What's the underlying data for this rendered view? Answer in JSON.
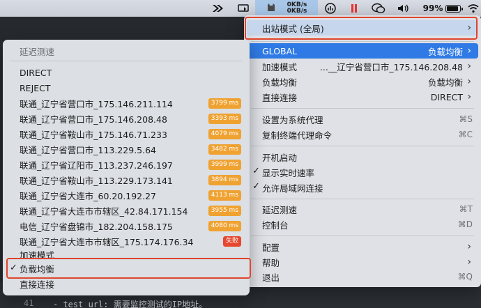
{
  "menubar": {
    "speed_up": "0KB/s",
    "speed_down": "0KB/s",
    "battery_percent": "99%"
  },
  "editor": {
    "line_number": "41",
    "code": "- test_url: 需要监控测试的IP地址。"
  },
  "main_menu": {
    "outbound_mode": "出站模式 (全局)",
    "global_label": "GLOBAL",
    "global_value": "负载均衡",
    "accel_label": "加速模式",
    "accel_value": "...__辽宁省营口市_175.146.208.48",
    "lb_label": "负载均衡",
    "lb_value": "负载均衡",
    "direct_label": "直接连接",
    "direct_value": "DIRECT",
    "set_proxy": "设置为系统代理",
    "set_proxy_sc": "⌘S",
    "copy_cmd": "复制终端代理命令",
    "copy_cmd_sc": "⌘C",
    "autostart": "开机启动",
    "show_speed": "显示实时速率",
    "show_speed_checked": true,
    "allow_lan": "允许局域网连接",
    "allow_lan_checked": true,
    "latency_test": "延迟测速",
    "latency_test_sc": "⌘T",
    "console": "控制台",
    "console_sc": "⌘D",
    "config": "配置",
    "help": "帮助",
    "quit": "退出",
    "quit_sc": "⌘Q"
  },
  "sub_menu": {
    "header": "延迟测速",
    "direct": "DIRECT",
    "reject": "REJECT",
    "proxies": [
      {
        "name": "联通_辽宁省营口市_175.146.211.114",
        "latency": "3799 ms"
      },
      {
        "name": "联通_辽宁省营口市_175.146.208.48",
        "latency": "3393 ms"
      },
      {
        "name": "联通_辽宁省鞍山市_175.146.71.233",
        "latency": "4079 ms"
      },
      {
        "name": "联通_辽宁省营口市_113.229.5.64",
        "latency": "3482 ms"
      },
      {
        "name": "联通_辽宁省辽阳市_113.237.246.197",
        "latency": "3999 ms"
      },
      {
        "name": "联通_辽宁省鞍山市_113.229.173.141",
        "latency": "3894 ms"
      },
      {
        "name": "联通_辽宁省大连市_60.20.192.27",
        "latency": "4113 ms"
      },
      {
        "name": "联通_辽宁省大连市市辖区_42.84.171.154",
        "latency": "3955 ms"
      },
      {
        "name": "电信_辽宁省盘锦市_182.204.158.175",
        "latency": "4080 ms"
      },
      {
        "name": "联通_辽宁省大连市市辖区_175.174.176.34",
        "latency": "失败"
      }
    ],
    "accel": "加速模式",
    "lb": "负载均衡",
    "lb_checked": true,
    "direct_conn": "直接连接"
  },
  "colors": {
    "highlight": "#2f7ae5",
    "badge": "#f0a231",
    "badge_fail": "#e5482d",
    "annotation": "#e0452d"
  }
}
